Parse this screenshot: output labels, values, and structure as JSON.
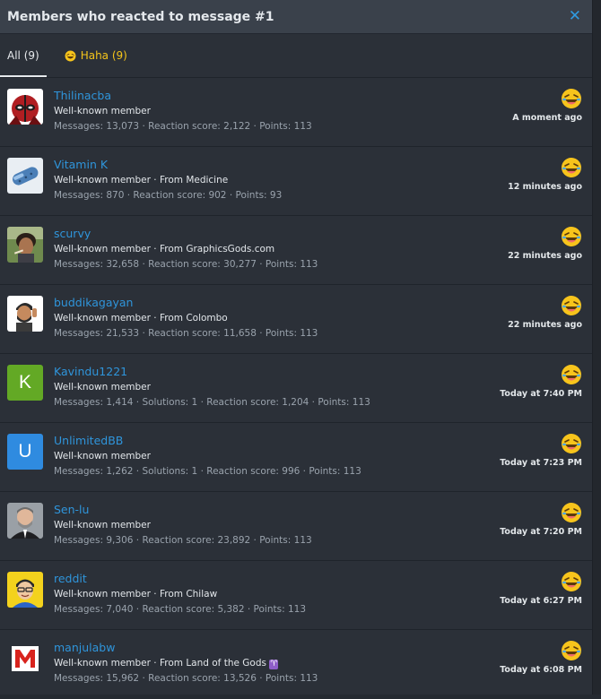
{
  "modal": {
    "title": "Members who reacted to message #1",
    "close_symbol": "✕"
  },
  "tabs": [
    {
      "label": "All (9)",
      "active": true
    },
    {
      "label": "Haha (9)",
      "active": false,
      "icon": "laughing-emoji-icon"
    }
  ],
  "colors": {
    "username": "#2f95db",
    "haha": "#f5c51a",
    "background": "#2b3038",
    "header": "#3a414b"
  },
  "members": [
    {
      "name": "Thilinacba",
      "title": "Well-known member",
      "stats": "Messages: 13,073 · Reaction score: 2,122 · Points: 113",
      "time": "A moment ago",
      "avatar": "deadpool-avatar"
    },
    {
      "name": "Vitamin K",
      "title": "Well-known member · From Medicine",
      "stats": "Messages: 870 · Reaction score: 902 · Points: 93",
      "time": "12 minutes ago",
      "avatar": "pills-avatar"
    },
    {
      "name": "scurvy",
      "title": "Well-known member · From GraphicsGods.com",
      "stats": "Messages: 32,658 · Reaction score: 30,277 · Points: 113",
      "time": "22 minutes ago",
      "avatar": "photo-avatar"
    },
    {
      "name": "buddikagayan",
      "title": "Well-known member · From Colombo",
      "stats": "Messages: 21,533 · Reaction score: 11,658 · Points: 113",
      "time": "22 minutes ago",
      "avatar": "memoji-avatar"
    },
    {
      "name": "Kavindu1221",
      "title": "Well-known member",
      "stats": "Messages: 1,414 · Solutions: 1 · Reaction score: 1,204 · Points: 113",
      "time": "Today at 7:40 PM",
      "avatar": "letter-avatar",
      "letter": "K",
      "avatar_color": "#63a925"
    },
    {
      "name": "UnlimitedBB",
      "title": "Well-known member",
      "stats": "Messages: 1,262 · Solutions: 1 · Reaction score: 996 · Points: 113",
      "time": "Today at 7:23 PM",
      "avatar": "letter-avatar",
      "letter": "U",
      "avatar_color": "#2f8be0"
    },
    {
      "name": "Sen-lu",
      "title": "Well-known member",
      "stats": "Messages: 9,306 · Reaction score: 23,892 · Points: 113",
      "time": "Today at 7:20 PM",
      "avatar": "photo-avatar"
    },
    {
      "name": "reddit",
      "title": "Well-known member · From Chilaw",
      "stats": "Messages: 7,040 · Reaction score: 5,382 · Points: 113",
      "time": "Today at 6:27 PM",
      "avatar": "cartoon-avatar"
    },
    {
      "name": "manjulabw",
      "title": "Well-known member · From Land of the Gods",
      "title_badge": "♈",
      "stats": "Messages: 15,962 · Reaction score: 13,526 · Points: 113",
      "time": "Today at 6:08 PM",
      "avatar": "logo-avatar"
    }
  ]
}
